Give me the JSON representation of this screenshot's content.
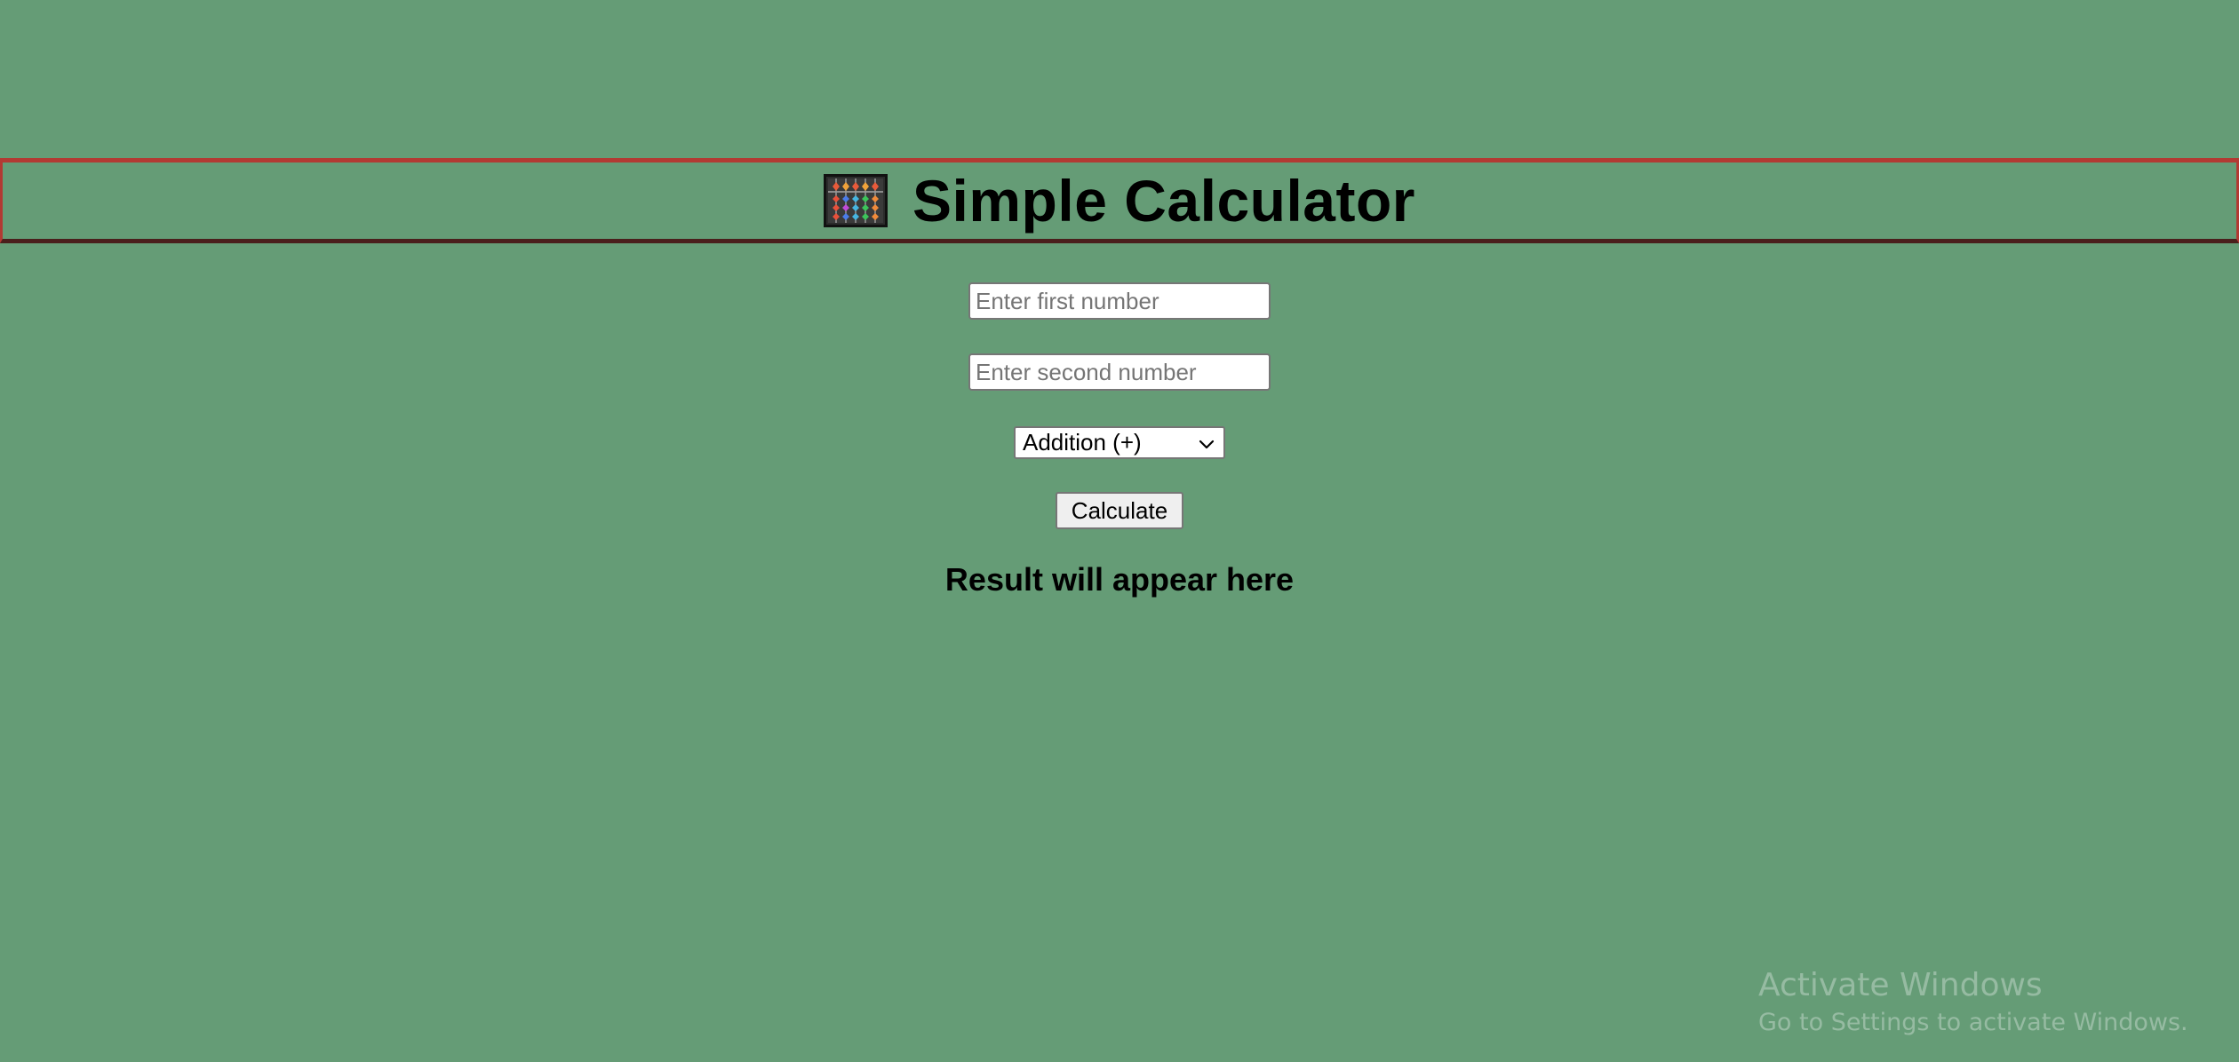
{
  "header": {
    "icon": "abacus-icon",
    "title": "Simple Calculator",
    "border_color": "#b23a33"
  },
  "form": {
    "first_number": {
      "value": "",
      "placeholder": "Enter first number"
    },
    "second_number": {
      "value": "",
      "placeholder": "Enter second number"
    },
    "operation": {
      "selected": "Addition (+)",
      "icon": "chevron-down-icon"
    },
    "calculate_label": "Calculate"
  },
  "result": {
    "text": "Result will appear here"
  },
  "watermark": {
    "title": "Activate Windows",
    "subtitle": "Go to Settings to activate Windows."
  },
  "colors": {
    "background": "#659c76",
    "header_border": "#b23a33"
  }
}
